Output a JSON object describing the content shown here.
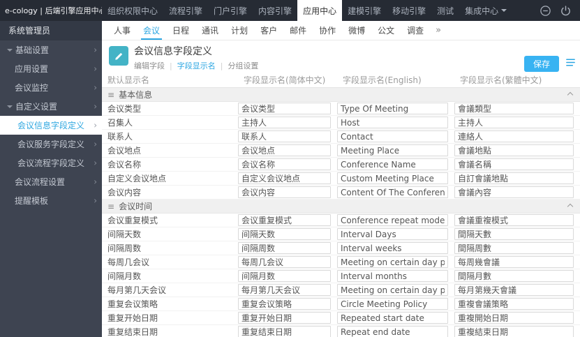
{
  "icons": {
    "menu": "≡",
    "more": "»",
    "chevron_right": "›",
    "tab_separator": "|"
  },
  "colors": {
    "accent_blue": "#2ba6e2",
    "topbar_bg": "#262b34",
    "sidebar_bg": "#3e4451",
    "save_button_bg": "#38b3f2",
    "head_icon_bg": "#43b3c6"
  },
  "topbar": {
    "brand": "e-cology | 后端引擎应用中心",
    "items": [
      {
        "label": "组织权限中心"
      },
      {
        "label": "流程引擎"
      },
      {
        "label": "门户引擎"
      },
      {
        "label": "内容引擎"
      },
      {
        "label": "应用中心",
        "active": true
      },
      {
        "label": "建模引擎"
      },
      {
        "label": "移动引擎"
      },
      {
        "label": "测试"
      },
      {
        "label": "集成中心",
        "caret": true
      }
    ]
  },
  "subnav": {
    "items": [
      {
        "label": "人事"
      },
      {
        "label": "会议",
        "active": true
      },
      {
        "label": "日程"
      },
      {
        "label": "通讯"
      },
      {
        "label": "计划"
      },
      {
        "label": "客户"
      },
      {
        "label": "邮件"
      },
      {
        "label": "协作"
      },
      {
        "label": "微博"
      },
      {
        "label": "公文"
      },
      {
        "label": "调查"
      }
    ]
  },
  "sidebar": {
    "user": "系统管理员",
    "items": [
      {
        "label": "基础设置",
        "level": 0,
        "group": true
      },
      {
        "label": "应用设置",
        "level": 1
      },
      {
        "label": "会议监控",
        "level": 1
      },
      {
        "label": "自定义设置",
        "level": 0,
        "group": true
      },
      {
        "label": "会议信息字段定义",
        "level": 2,
        "active": true
      },
      {
        "label": "会议服务字段定义",
        "level": 2
      },
      {
        "label": "会议流程字段定义",
        "level": 2
      },
      {
        "label": "会议流程设置",
        "level": 1
      },
      {
        "label": "提醒模板",
        "level": 1
      }
    ]
  },
  "main": {
    "title": "会议信息字段定义",
    "tabs": [
      {
        "label": "编辑字段"
      },
      {
        "label": "字段显示名",
        "active": true
      },
      {
        "label": "分组设置"
      }
    ],
    "save_label": "保存",
    "table": {
      "headers": [
        "默认显示名",
        "字段显示名(简体中文)",
        "字段显示名(English)",
        "字段显示名(繁體中文)"
      ],
      "sections": [
        {
          "title": "基本信息",
          "rows": [
            {
              "default": "会议类型",
              "zh_cn": "会议类型",
              "en": "Type Of Meeting",
              "zh_tw": "會議類型"
            },
            {
              "default": "召集人",
              "zh_cn": "主持人",
              "en": "Host",
              "zh_tw": "主持人"
            },
            {
              "default": "联系人",
              "zh_cn": "联系人",
              "en": "Contact",
              "zh_tw": "連絡人"
            },
            {
              "default": "会议地点",
              "zh_cn": "会议地点",
              "en": "Meeting Place",
              "zh_tw": "會議地點"
            },
            {
              "default": "会议名称",
              "zh_cn": "会议名称",
              "en": "Conference Name",
              "zh_tw": "會議名稱"
            },
            {
              "default": "自定义会议地点",
              "zh_cn": "自定义会议地点",
              "en": "Custom Meeting Place",
              "zh_tw": "自訂會議地點"
            },
            {
              "default": "会议内容",
              "zh_cn": "会议内容",
              "en": "Content Of The Conference",
              "zh_tw": "會議內容"
            }
          ]
        },
        {
          "title": "会议时间",
          "rows": [
            {
              "default": "会议重复模式",
              "zh_cn": "会议重复模式",
              "en": "Conference repeat mode",
              "zh_tw": "會議重複模式"
            },
            {
              "default": "间隔天数",
              "zh_cn": "间隔天数",
              "en": "Interval Days",
              "zh_tw": "間隔天數"
            },
            {
              "default": "间隔周数",
              "zh_cn": "间隔周数",
              "en": "Interval weeks",
              "zh_tw": "間隔周數"
            },
            {
              "default": "每周几会议",
              "zh_cn": "每周几会议",
              "en": "Meeting on certain day per week",
              "zh_tw": "每周幾會議"
            },
            {
              "default": "间隔月数",
              "zh_cn": "间隔月数",
              "en": "Interval months",
              "zh_tw": "間隔月數"
            },
            {
              "default": "每月第几天会议",
              "zh_cn": "每月第几天会议",
              "en": "Meeting on certain day per month",
              "zh_tw": "每月第幾天會議"
            },
            {
              "default": "重复会议策略",
              "zh_cn": "重复会议策略",
              "en": "Circle Meeting Policy",
              "zh_tw": "重複會議策略"
            },
            {
              "default": "重复开始日期",
              "zh_cn": "重复开始日期",
              "en": "Repeated start date",
              "zh_tw": "重複開始日期"
            },
            {
              "default": "重复结束日期",
              "zh_cn": "重复结束日期",
              "en": "Repeat end date",
              "zh_tw": "重複結束日期"
            }
          ]
        }
      ]
    }
  }
}
